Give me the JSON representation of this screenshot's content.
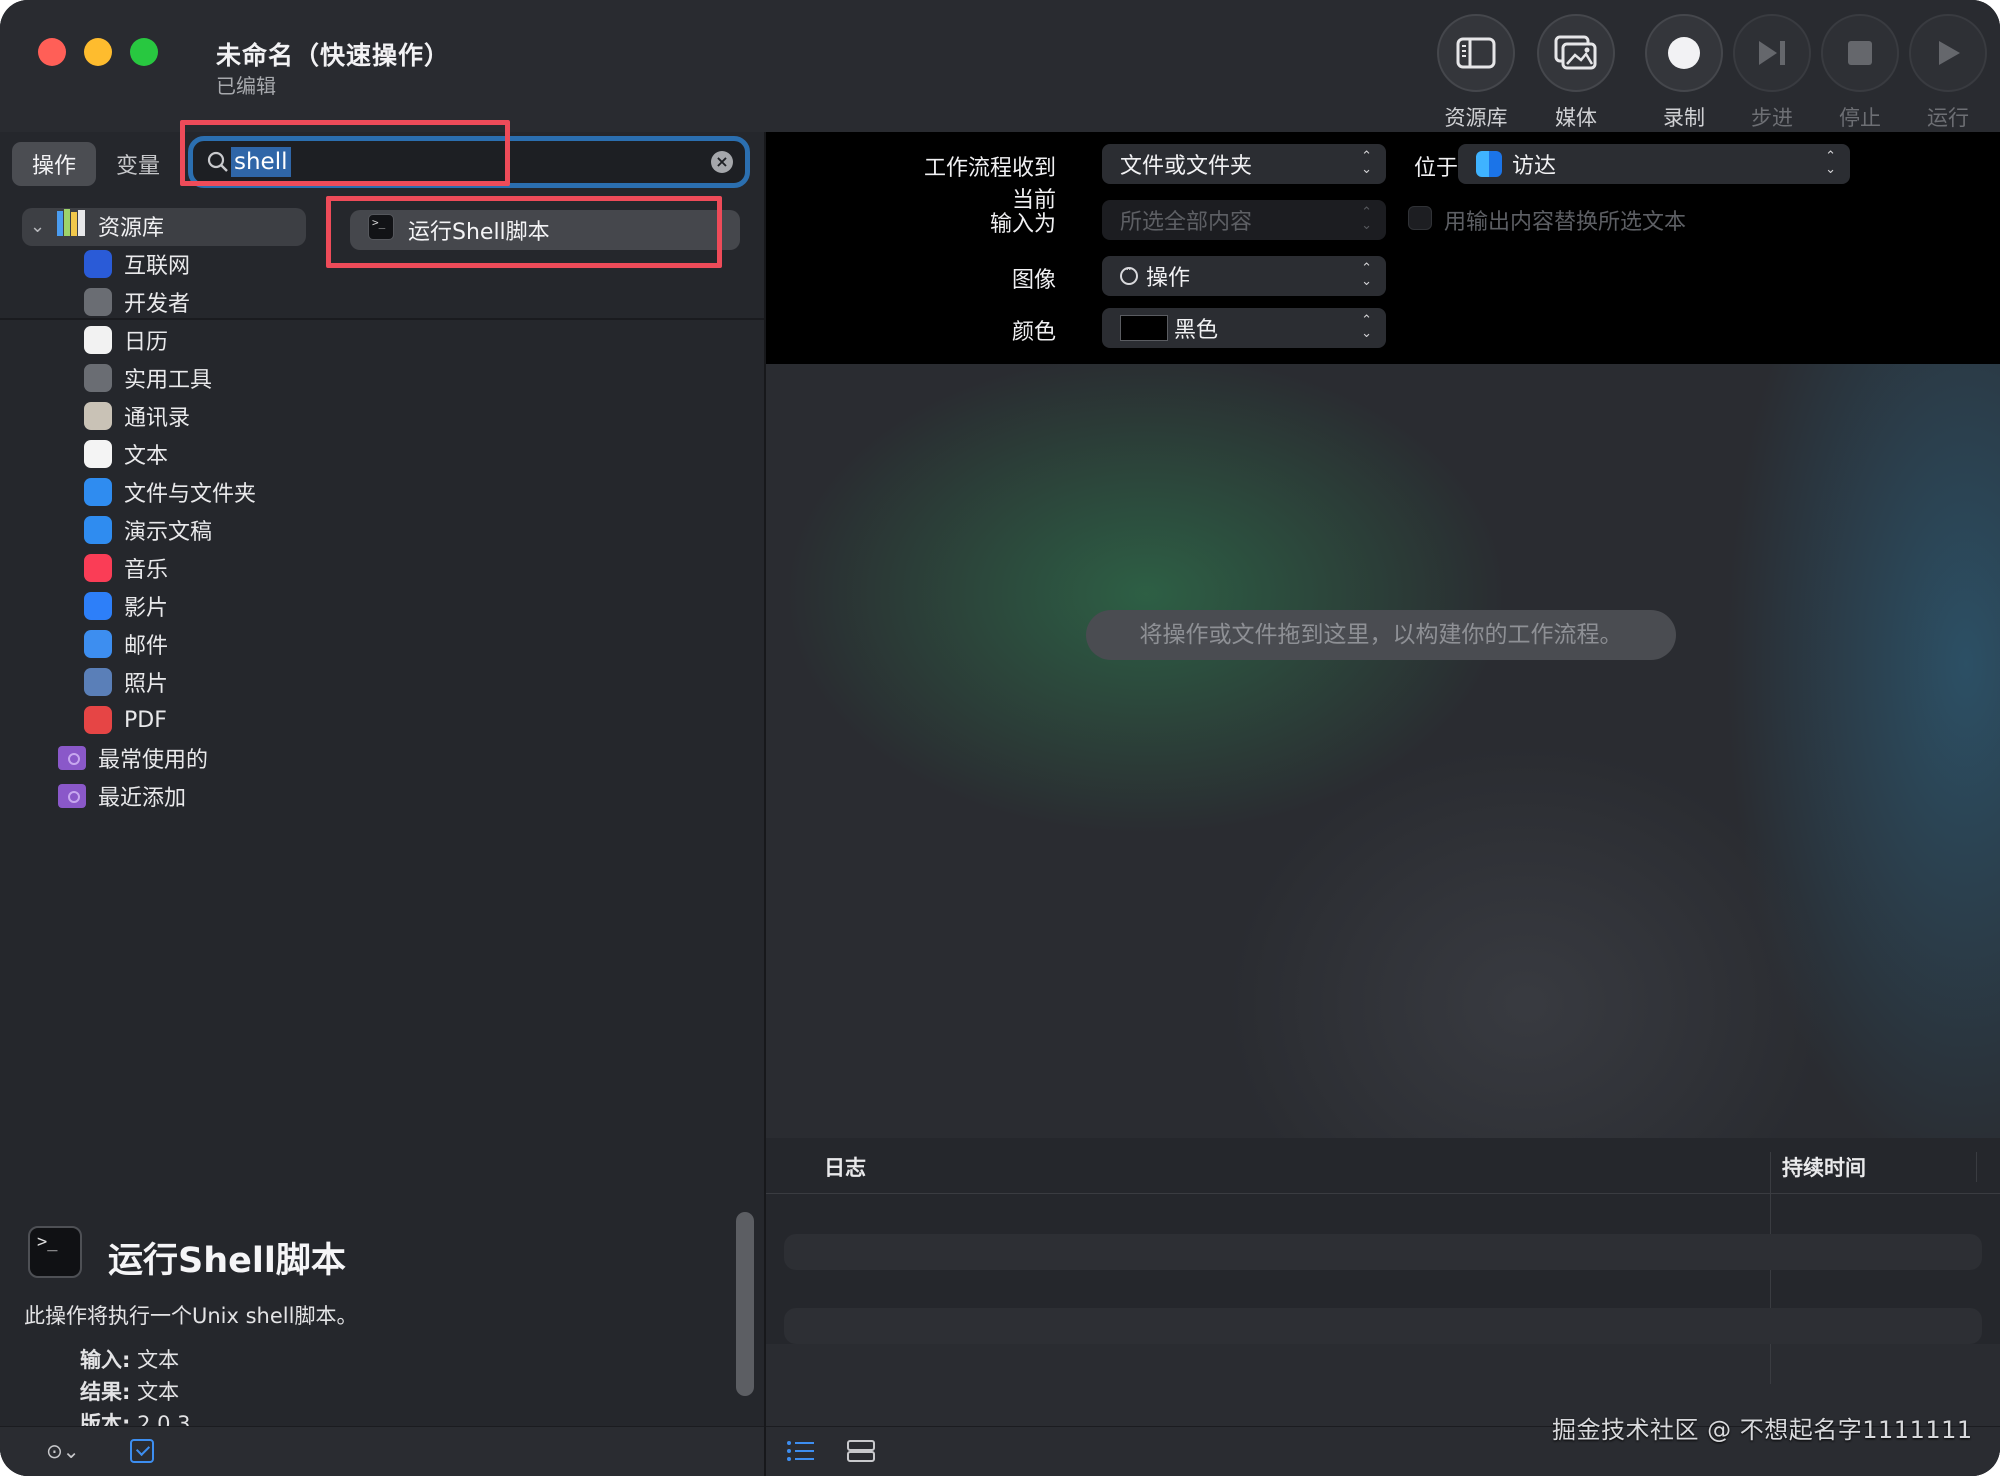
{
  "window": {
    "title": "未命名（快速操作）",
    "subtitle": "已编辑"
  },
  "toolbar": {
    "buttons": [
      {
        "label": "资源库",
        "icon": "sidebar-icon",
        "enabled": true
      },
      {
        "label": "媒体",
        "icon": "media-icon",
        "enabled": true
      },
      {
        "label": "录制",
        "icon": "record-icon",
        "enabled": true
      },
      {
        "label": "步进",
        "icon": "step-icon",
        "enabled": false
      },
      {
        "label": "停止",
        "icon": "stop-icon",
        "enabled": false
      },
      {
        "label": "运行",
        "icon": "run-icon",
        "enabled": false
      }
    ]
  },
  "left": {
    "tabs": [
      {
        "label": "操作",
        "active": true
      },
      {
        "label": "变量",
        "active": false
      }
    ],
    "search": {
      "value": "shell",
      "placeholder": ""
    },
    "library": {
      "root_label": "资源库",
      "categories": [
        {
          "label": "互联网",
          "icon": "globe-icon",
          "color": "#2a5bd7"
        },
        {
          "label": "开发者",
          "icon": "tools-icon",
          "color": "#6a6d73"
        },
        {
          "label": "日历",
          "icon": "calendar-icon",
          "color": "#f2f2f2"
        },
        {
          "label": "实用工具",
          "icon": "utilities-icon",
          "color": "#6a6d73"
        },
        {
          "label": "通讯录",
          "icon": "contacts-icon",
          "color": "#c9c2b6"
        },
        {
          "label": "文本",
          "icon": "text-icon",
          "color": "#f4f4f4"
        },
        {
          "label": "文件与文件夹",
          "icon": "finder-icon",
          "color": "#2f8cf0"
        },
        {
          "label": "演示文稿",
          "icon": "keynote-icon",
          "color": "#2f8cf0"
        },
        {
          "label": "音乐",
          "icon": "music-icon",
          "color": "#fa3d56"
        },
        {
          "label": "影片",
          "icon": "quicktime-icon",
          "color": "#2d7ff9"
        },
        {
          "label": "邮件",
          "icon": "mail-icon",
          "color": "#3d8ef0"
        },
        {
          "label": "照片",
          "icon": "camera-icon",
          "color": "#5a7fb8"
        },
        {
          "label": "PDF",
          "icon": "pdf-icon",
          "color": "#e64545"
        }
      ],
      "smart_groups": [
        {
          "label": "最常使用的",
          "icon": "smart-folder-icon"
        },
        {
          "label": "最近添加",
          "icon": "smart-folder-icon"
        }
      ]
    },
    "results": [
      {
        "label": "运行Shell脚本",
        "icon": "terminal-icon"
      }
    ],
    "description": {
      "title": "运行Shell脚本",
      "text": "此操作将执行一个Unix shell脚本。",
      "input_label": "输入:",
      "input_value": "文本",
      "result_label": "结果:",
      "result_value": "文本",
      "version_label": "版本:",
      "version_value": "2.0.3"
    }
  },
  "workflow": {
    "receives_label": "工作流程收到当前",
    "receives_value": "文件或文件夹",
    "in_label": "位于",
    "in_value": "访达",
    "input_is_label": "输入为",
    "input_is_value": "所选全部内容",
    "replace_label": "用输出内容替换所选文本",
    "image_label": "图像",
    "image_value": "操作",
    "color_label": "颜色",
    "color_value": "黑色",
    "drop_hint": "将操作或文件拖到这里，以构建你的工作流程。"
  },
  "log": {
    "col_log": "日志",
    "col_duration": "持续时间"
  },
  "watermark": "掘金技术社区 @ 不想起名字1111111",
  "colors": {
    "highlight": "#ee4b59",
    "accent": "#2b6fb0",
    "traffic_red": "#ff5f57",
    "traffic_yellow": "#febc2e",
    "traffic_green": "#28c840"
  }
}
